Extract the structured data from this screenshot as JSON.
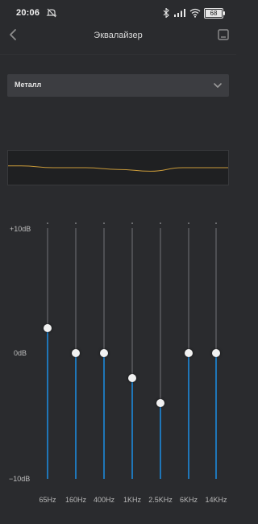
{
  "status": {
    "time": "20:06",
    "battery": "68"
  },
  "header": {
    "title": "Эквалайзер"
  },
  "preset": {
    "selected": "Металл"
  },
  "scale": {
    "top": "+10dB",
    "mid": "0dB",
    "bottom": "−10dB"
  },
  "bands": [
    {
      "label": "65Hz",
      "gain_db": 2
    },
    {
      "label": "160Hz",
      "gain_db": 0
    },
    {
      "label": "400Hz",
      "gain_db": 0
    },
    {
      "label": "1KHz",
      "gain_db": -2
    },
    {
      "label": "2.5KHz",
      "gain_db": -4
    },
    {
      "label": "6KHz",
      "gain_db": 0
    },
    {
      "label": "14KHz",
      "gain_db": 0
    }
  ],
  "colors": {
    "accent": "#1f76b8",
    "curve": "#c99a3a",
    "background": "#2a2b2e"
  },
  "icons": {
    "back": "chevron-left-icon",
    "save": "save-icon",
    "dropdown": "chevron-down-icon"
  }
}
